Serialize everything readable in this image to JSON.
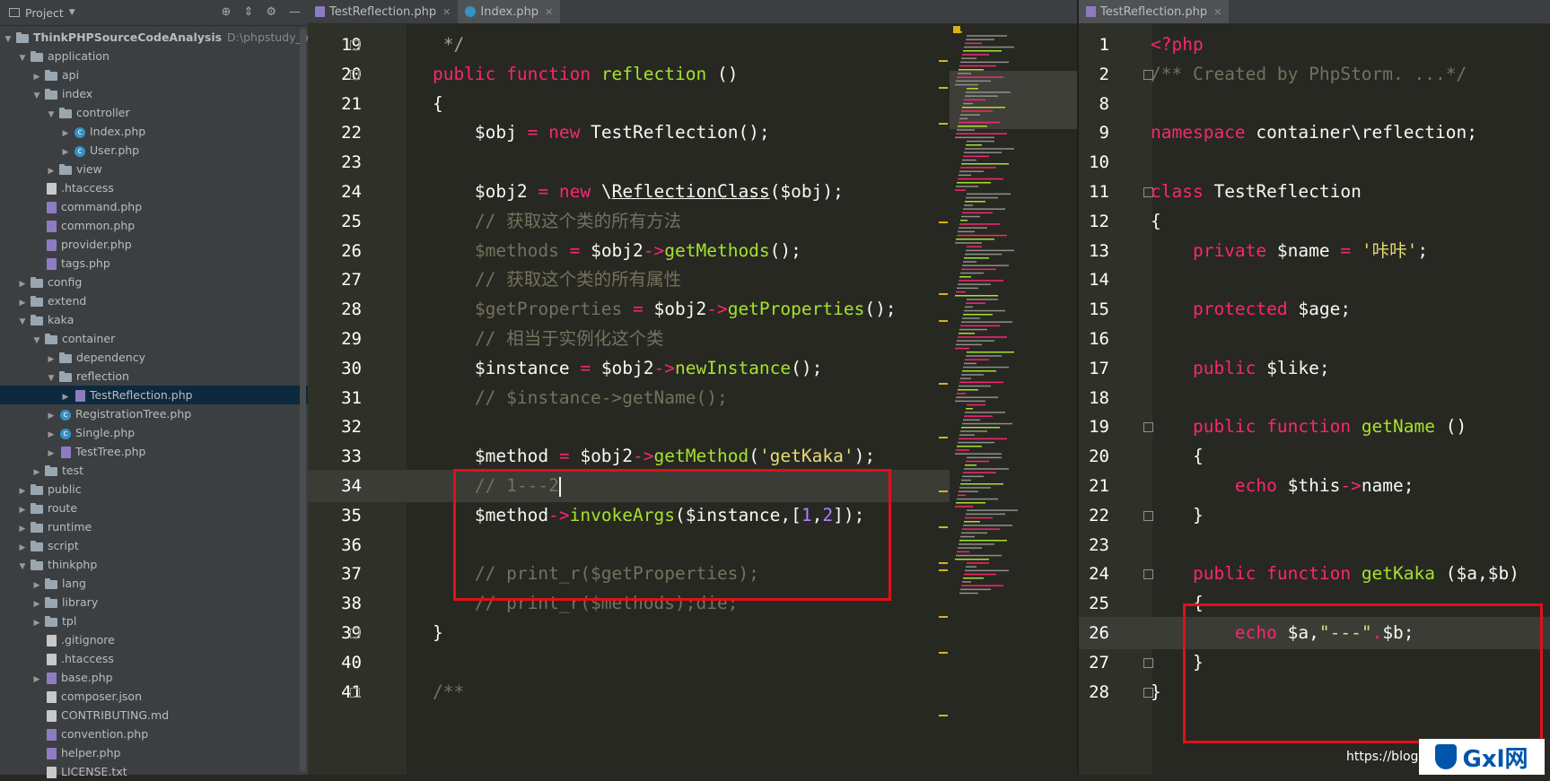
{
  "project": {
    "title": "Project",
    "tree": [
      {
        "label": "ThinkPHPSourceCodeAnalysis",
        "hint": "D:\\phpstudy_pro\\W",
        "type": "folder",
        "depth": 0,
        "open": true,
        "bold": true
      },
      {
        "label": "application",
        "type": "folder",
        "depth": 1,
        "open": true
      },
      {
        "label": "api",
        "type": "folder",
        "depth": 2,
        "open": false
      },
      {
        "label": "index",
        "type": "folder",
        "depth": 2,
        "open": true
      },
      {
        "label": "controller",
        "type": "folder",
        "depth": 3,
        "open": true
      },
      {
        "label": "Index.php",
        "type": "class",
        "depth": 4,
        "open": false
      },
      {
        "label": "User.php",
        "type": "class",
        "depth": 4,
        "open": false
      },
      {
        "label": "view",
        "type": "folder",
        "depth": 3,
        "open": false
      },
      {
        "label": ".htaccess",
        "type": "file",
        "depth": 2
      },
      {
        "label": "command.php",
        "type": "php",
        "depth": 2
      },
      {
        "label": "common.php",
        "type": "php",
        "depth": 2
      },
      {
        "label": "provider.php",
        "type": "php",
        "depth": 2
      },
      {
        "label": "tags.php",
        "type": "php",
        "depth": 2
      },
      {
        "label": "config",
        "type": "folder",
        "depth": 1,
        "open": false
      },
      {
        "label": "extend",
        "type": "folder",
        "depth": 1,
        "open": false
      },
      {
        "label": "kaka",
        "type": "folder",
        "depth": 1,
        "open": true
      },
      {
        "label": "container",
        "type": "folder",
        "depth": 2,
        "open": true
      },
      {
        "label": "dependency",
        "type": "folder",
        "depth": 3,
        "open": false
      },
      {
        "label": "reflection",
        "type": "folder",
        "depth": 3,
        "open": true
      },
      {
        "label": "TestReflection.php",
        "type": "php",
        "depth": 4,
        "open": false,
        "selected": true
      },
      {
        "label": "RegistrationTree.php",
        "type": "class",
        "depth": 3,
        "open": false
      },
      {
        "label": "Single.php",
        "type": "class",
        "depth": 3,
        "open": false
      },
      {
        "label": "TestTree.php",
        "type": "php",
        "depth": 3,
        "open": false
      },
      {
        "label": "test",
        "type": "folder",
        "depth": 2,
        "open": false
      },
      {
        "label": "public",
        "type": "folder",
        "depth": 1,
        "open": false
      },
      {
        "label": "route",
        "type": "folder",
        "depth": 1,
        "open": false
      },
      {
        "label": "runtime",
        "type": "folder",
        "depth": 1,
        "open": false
      },
      {
        "label": "script",
        "type": "folder",
        "depth": 1,
        "open": false
      },
      {
        "label": "thinkphp",
        "type": "folder",
        "depth": 1,
        "open": true
      },
      {
        "label": "lang",
        "type": "folder",
        "depth": 2,
        "open": false
      },
      {
        "label": "library",
        "type": "folder",
        "depth": 2,
        "open": false
      },
      {
        "label": "tpl",
        "type": "folder",
        "depth": 2,
        "open": false
      },
      {
        "label": ".gitignore",
        "type": "file",
        "depth": 2
      },
      {
        "label": ".htaccess",
        "type": "file",
        "depth": 2
      },
      {
        "label": "base.php",
        "type": "php",
        "depth": 2,
        "open": false
      },
      {
        "label": "composer.json",
        "type": "file",
        "depth": 2
      },
      {
        "label": "CONTRIBUTING.md",
        "type": "file",
        "depth": 2
      },
      {
        "label": "convention.php",
        "type": "php",
        "depth": 2
      },
      {
        "label": "helper.php",
        "type": "php",
        "depth": 2
      },
      {
        "label": "LICENSE.txt",
        "type": "file",
        "depth": 2
      }
    ]
  },
  "left_editor": {
    "tabs": [
      {
        "label": "TestReflection.php",
        "active": false
      },
      {
        "label": "Index.php",
        "active": true
      }
    ],
    "lines": [
      {
        "no": "19",
        "seg": [
          [
            "g",
            "     */"
          ]
        ]
      },
      {
        "no": "20",
        "seg": [
          [
            "k",
            "    public function "
          ],
          [
            "f",
            "reflection"
          ],
          [
            "v",
            " ()"
          ]
        ]
      },
      {
        "no": "21",
        "seg": [
          [
            "v",
            "    {"
          ]
        ]
      },
      {
        "no": "22",
        "seg": [
          [
            "v",
            "        $obj "
          ],
          [
            "k",
            "= new "
          ],
          [
            "v",
            "TestReflection();"
          ]
        ]
      },
      {
        "no": "23",
        "seg": []
      },
      {
        "no": "24",
        "seg": [
          [
            "v",
            "        $obj2 "
          ],
          [
            "k",
            "= new "
          ],
          [
            "v",
            "\\"
          ],
          [
            "cls",
            "ReflectionClass"
          ],
          [
            "v",
            "($obj);"
          ]
        ]
      },
      {
        "no": "25",
        "seg": [
          [
            "c",
            "        // 获取这个类的所有方法"
          ]
        ]
      },
      {
        "no": "26",
        "seg": [
          [
            "c",
            "        $methods "
          ],
          [
            "k",
            "= "
          ],
          [
            "v",
            "$obj2"
          ],
          [
            "k",
            "->"
          ],
          [
            "f",
            "getMethods"
          ],
          [
            "v",
            "();"
          ]
        ]
      },
      {
        "no": "27",
        "seg": [
          [
            "c",
            "        // 获取这个类的所有属性"
          ]
        ]
      },
      {
        "no": "28",
        "seg": [
          [
            "c",
            "        $getProperties "
          ],
          [
            "k",
            "= "
          ],
          [
            "v",
            "$obj2"
          ],
          [
            "k",
            "->"
          ],
          [
            "f",
            "getProperties"
          ],
          [
            "v",
            "();"
          ]
        ]
      },
      {
        "no": "29",
        "seg": [
          [
            "c",
            "        // 相当于实例化这个类"
          ]
        ]
      },
      {
        "no": "30",
        "seg": [
          [
            "v",
            "        $instance "
          ],
          [
            "k",
            "= "
          ],
          [
            "v",
            "$obj2"
          ],
          [
            "k",
            "->"
          ],
          [
            "f",
            "newInstance"
          ],
          [
            "v",
            "();"
          ]
        ]
      },
      {
        "no": "31",
        "seg": [
          [
            "c",
            "        // $instance->getName();"
          ]
        ]
      },
      {
        "no": "32",
        "seg": []
      },
      {
        "no": "33",
        "seg": [
          [
            "v",
            "        $method "
          ],
          [
            "k",
            "= "
          ],
          [
            "v",
            "$obj2"
          ],
          [
            "k",
            "->"
          ],
          [
            "f",
            "getMethod"
          ],
          [
            "v",
            "("
          ],
          [
            "s",
            "'getKaka'"
          ],
          [
            "v",
            ");"
          ]
        ]
      },
      {
        "no": "34",
        "seg": [
          [
            "c",
            "        // 1---2"
          ]
        ],
        "current": true
      },
      {
        "no": "35",
        "seg": [
          [
            "v",
            "        $method"
          ],
          [
            "k",
            "->"
          ],
          [
            "f",
            "invokeArgs"
          ],
          [
            "v",
            "($instance,["
          ],
          [
            "n",
            "1"
          ],
          [
            "v",
            ","
          ],
          [
            "n",
            "2"
          ],
          [
            "v",
            "]);"
          ]
        ]
      },
      {
        "no": "36",
        "seg": []
      },
      {
        "no": "37",
        "seg": [
          [
            "c",
            "        // print_r($getProperties);"
          ]
        ]
      },
      {
        "no": "38",
        "seg": [
          [
            "c",
            "        // print_r($methods);die;"
          ]
        ]
      },
      {
        "no": "39",
        "seg": [
          [
            "v",
            "    }"
          ]
        ]
      },
      {
        "no": "40",
        "seg": []
      },
      {
        "no": "41",
        "seg": [
          [
            "c",
            "    /**"
          ]
        ]
      }
    ]
  },
  "right_editor": {
    "tabs": [
      {
        "label": "TestReflection.php",
        "active": true
      }
    ],
    "lines": [
      {
        "no": "1",
        "seg": [
          [
            "k",
            "<?php"
          ]
        ]
      },
      {
        "no": "2",
        "seg": [
          [
            "c",
            "/** "
          ],
          [
            "c",
            "Created by PhpStorm. ..."
          ],
          [
            "c",
            "*/"
          ]
        ]
      },
      {
        "no": "8",
        "seg": []
      },
      {
        "no": "9",
        "seg": [
          [
            "k",
            "namespace "
          ],
          [
            "v",
            "container\\reflection;"
          ]
        ]
      },
      {
        "no": "10",
        "seg": []
      },
      {
        "no": "11",
        "seg": [
          [
            "k",
            "class "
          ],
          [
            "v",
            "TestReflection"
          ]
        ]
      },
      {
        "no": "12",
        "seg": [
          [
            "v",
            "{"
          ]
        ]
      },
      {
        "no": "13",
        "seg": [
          [
            "k",
            "    private "
          ],
          [
            "v",
            "$name "
          ],
          [
            "k",
            "= "
          ],
          [
            "s",
            "'咔咔'"
          ],
          [
            "v",
            ";"
          ]
        ]
      },
      {
        "no": "14",
        "seg": []
      },
      {
        "no": "15",
        "seg": [
          [
            "k",
            "    protected "
          ],
          [
            "v",
            "$age;"
          ]
        ]
      },
      {
        "no": "16",
        "seg": []
      },
      {
        "no": "17",
        "seg": [
          [
            "k",
            "    public "
          ],
          [
            "v",
            "$like;"
          ]
        ]
      },
      {
        "no": "18",
        "seg": []
      },
      {
        "no": "19",
        "seg": [
          [
            "k",
            "    public function "
          ],
          [
            "f",
            "getName"
          ],
          [
            "v",
            " ()"
          ]
        ]
      },
      {
        "no": "20",
        "seg": [
          [
            "v",
            "    {"
          ]
        ]
      },
      {
        "no": "21",
        "seg": [
          [
            "k",
            "        echo "
          ],
          [
            "v",
            "$this"
          ],
          [
            "k",
            "->"
          ],
          [
            "v",
            "name;"
          ]
        ]
      },
      {
        "no": "22",
        "seg": [
          [
            "v",
            "    }"
          ]
        ]
      },
      {
        "no": "23",
        "seg": []
      },
      {
        "no": "24",
        "seg": [
          [
            "k",
            "    public function "
          ],
          [
            "f",
            "getKaka"
          ],
          [
            "v",
            " ($a,$b)"
          ]
        ]
      },
      {
        "no": "25",
        "seg": [
          [
            "v",
            "    {"
          ]
        ]
      },
      {
        "no": "26",
        "seg": [
          [
            "k",
            "        echo "
          ],
          [
            "v",
            "$a,"
          ],
          [
            "s",
            "\"---\""
          ],
          [
            "k",
            "."
          ],
          [
            "v",
            "$b;"
          ]
        ],
        "current": true
      },
      {
        "no": "27",
        "seg": [
          [
            "v",
            "    }"
          ]
        ]
      },
      {
        "no": "28",
        "seg": [
          [
            "v",
            "}"
          ]
        ]
      }
    ]
  },
  "watermark": {
    "logo": "Gxl网",
    "url": "https://blog.c"
  },
  "colors": {
    "keyword": "#f92672",
    "function": "#a6e22e",
    "string": "#e6db74",
    "number": "#ae81ff",
    "comment": "#75715e",
    "highlight_box": "#e0101a"
  }
}
